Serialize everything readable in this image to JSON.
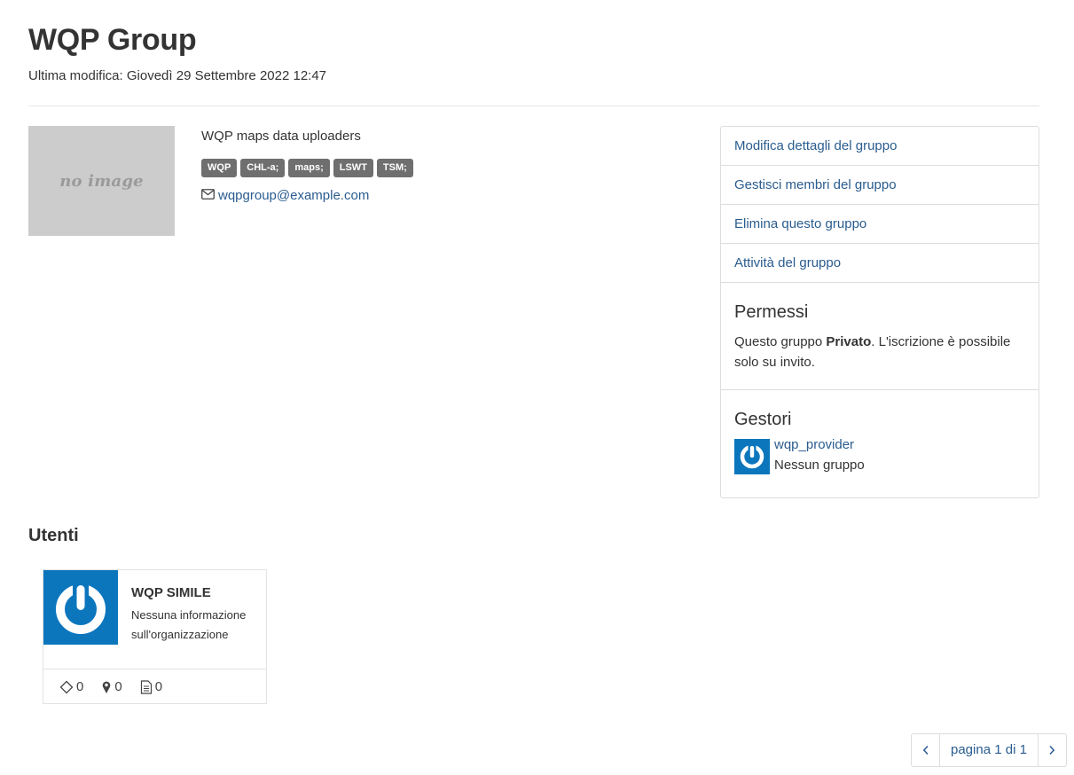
{
  "header": {
    "title": "WQP Group",
    "last_modified": "Ultima modifica: Giovedì 29 Settembre 2022 12:47"
  },
  "group": {
    "image_placeholder": "no image",
    "description": "WQP maps data uploaders",
    "tags": [
      "WQP",
      "CHL-a;",
      "maps;",
      "LSWT",
      "TSM;"
    ],
    "email": "wqpgroup@example.com"
  },
  "sidebar": {
    "links": [
      "Modifica dettagli del gruppo",
      "Gestisci membri del gruppo",
      "Elimina questo gruppo",
      "Attività del gruppo"
    ],
    "permissions": {
      "title": "Permessi",
      "text_before": "Questo gruppo ",
      "text_bold": "Privato",
      "text_after": ". L'iscrizione è possibile solo su invito."
    },
    "managers": {
      "title": "Gestori",
      "username": "wqp_provider",
      "group": "Nessun gruppo"
    }
  },
  "users": {
    "title": "Utenti",
    "cards": [
      {
        "name": "WQP SIMILE",
        "org": "Nessuna informazione sull'organizzazione",
        "stats": {
          "resources": "0",
          "maps": "0",
          "documents": "0"
        }
      }
    ]
  },
  "pagination": {
    "label": "pagina 1 di 1"
  },
  "colors": {
    "link": "#2a5c8f",
    "avatar_bg": "#0c76bd",
    "tag_bg": "#6f6f6f"
  }
}
